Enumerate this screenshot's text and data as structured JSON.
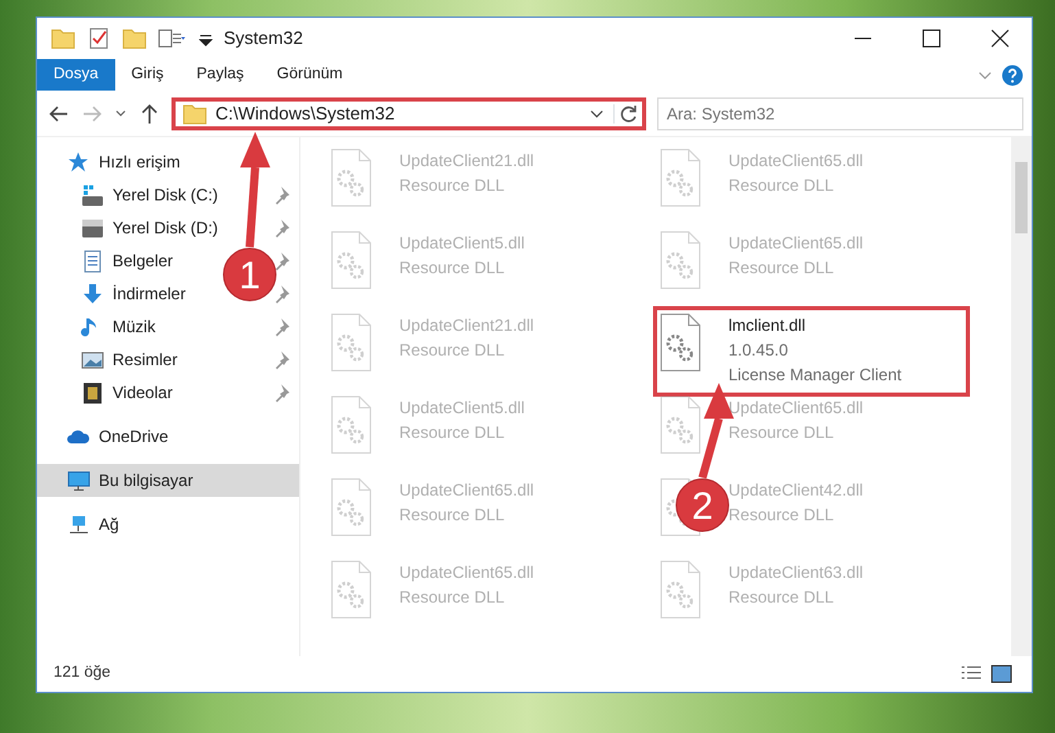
{
  "window": {
    "title": "System32"
  },
  "ribbon": {
    "tabs": [
      {
        "label": "Dosya",
        "selected": true
      },
      {
        "label": "Giriş",
        "selected": false
      },
      {
        "label": "Paylaş",
        "selected": false
      },
      {
        "label": "Görünüm",
        "selected": false
      }
    ]
  },
  "address_bar": {
    "path": "C:\\Windows\\System32",
    "highlighted": true
  },
  "search": {
    "placeholder": "Ara: System32"
  },
  "sidebar": {
    "items": [
      {
        "label": "Hızlı erişim",
        "kind": "star",
        "selected": false,
        "children": [
          {
            "label": "Yerel Disk (C:)",
            "kind": "windrive",
            "selected": false,
            "pinned": true
          },
          {
            "label": "Yerel Disk (D:)",
            "kind": "drive",
            "selected": false,
            "pinned": true
          },
          {
            "label": "Belgeler",
            "kind": "documents",
            "selected": false,
            "pinned": true
          },
          {
            "label": "İndirmeler",
            "kind": "downloads",
            "selected": false,
            "pinned": true
          },
          {
            "label": "Müzik",
            "kind": "music",
            "selected": false,
            "pinned": true
          },
          {
            "label": "Resimler",
            "kind": "pictures",
            "selected": false,
            "pinned": true
          },
          {
            "label": "Videolar",
            "kind": "videos",
            "selected": false,
            "pinned": true
          }
        ]
      },
      {
        "label": "OneDrive",
        "kind": "cloud",
        "selected": false
      },
      {
        "label": "Bu bilgisayar",
        "kind": "computer",
        "selected": true
      },
      {
        "label": "Ağ",
        "kind": "network",
        "selected": false
      }
    ]
  },
  "files": [
    {
      "name": "UpdateClient21.dll",
      "lines": [
        "Resource DLL"
      ],
      "faded": true,
      "highlighted": false
    },
    {
      "name": "UpdateClient65.dll",
      "lines": [
        "Resource DLL"
      ],
      "faded": true,
      "highlighted": false
    },
    {
      "name": "UpdateClient5.dll",
      "lines": [
        "Resource DLL"
      ],
      "faded": true,
      "highlighted": false
    },
    {
      "name": "UpdateClient65.dll",
      "lines": [
        "Resource DLL"
      ],
      "faded": true,
      "highlighted": false
    },
    {
      "name": "UpdateClient21.dll",
      "lines": [
        "Resource DLL"
      ],
      "faded": true,
      "highlighted": false
    },
    {
      "name": "lmclient.dll",
      "lines": [
        "1.0.45.0",
        "License Manager Client"
      ],
      "faded": false,
      "highlighted": true
    },
    {
      "name": "UpdateClient5.dll",
      "lines": [
        "Resource DLL"
      ],
      "faded": true,
      "highlighted": false
    },
    {
      "name": "UpdateClient65.dll",
      "lines": [
        "Resource DLL"
      ],
      "faded": true,
      "highlighted": false
    },
    {
      "name": "UpdateClient65.dll",
      "lines": [
        "Resource DLL"
      ],
      "faded": true,
      "highlighted": false
    },
    {
      "name": "UpdateClient42.dll",
      "lines": [
        "Resource DLL"
      ],
      "faded": true,
      "highlighted": false
    },
    {
      "name": "UpdateClient65.dll",
      "lines": [
        "Resource DLL"
      ],
      "faded": true,
      "highlighted": false
    },
    {
      "name": "UpdateClient63.dll",
      "lines": [
        "Resource DLL"
      ],
      "faded": true,
      "highlighted": false
    }
  ],
  "annotations": [
    {
      "label": "1"
    },
    {
      "label": "2"
    }
  ],
  "status_bar": {
    "item_count": "121 öğe"
  }
}
